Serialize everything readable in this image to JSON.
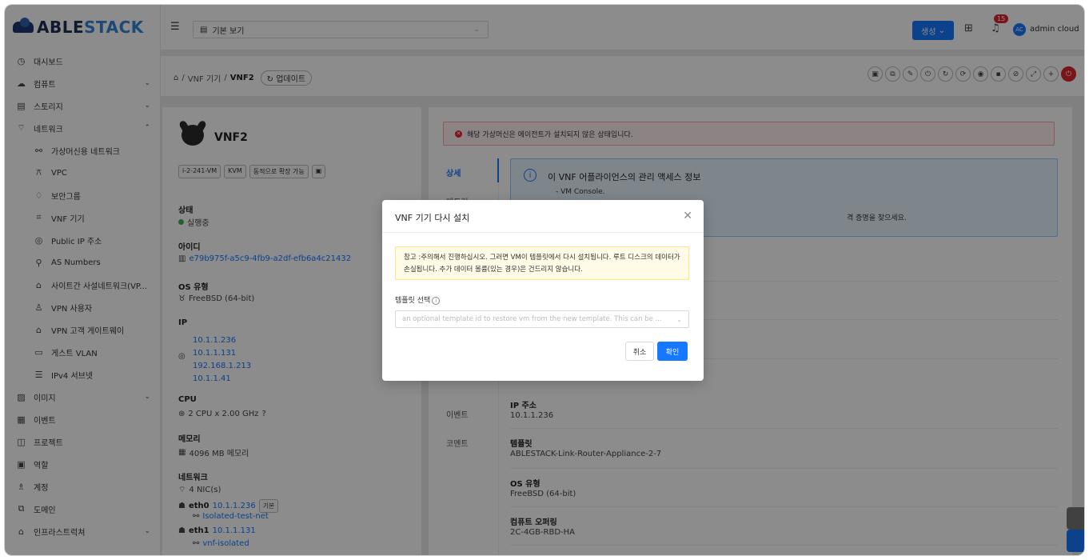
{
  "brand": {
    "part1": "ABLE",
    "part2": "STACK"
  },
  "sidebar": {
    "items": [
      {
        "icon": "◷",
        "label": "대시보드",
        "chev": "",
        "sub": false
      },
      {
        "icon": "☁",
        "label": "컴퓨트",
        "chev": "⌄",
        "sub": false
      },
      {
        "icon": "▤",
        "label": "스토리지",
        "chev": "⌄",
        "sub": false
      },
      {
        "icon": "⌔",
        "label": "네트워크",
        "chev": "⌃",
        "sub": false
      },
      {
        "icon": "⚯",
        "label": "가상머신용 네트워크",
        "chev": "",
        "sub": true
      },
      {
        "icon": "⚻",
        "label": "VPC",
        "chev": "",
        "sub": true
      },
      {
        "icon": "♢",
        "label": "보안그룹",
        "chev": "",
        "sub": true
      },
      {
        "icon": "⌗",
        "label": "VNF 기기",
        "chev": "",
        "sub": true
      },
      {
        "icon": "◎",
        "label": "Public IP 주소",
        "chev": "",
        "sub": true
      },
      {
        "icon": "⚲",
        "label": "AS Numbers",
        "chev": "",
        "sub": true
      },
      {
        "icon": "⌂",
        "label": "사이트간 사설네트워크(VP...",
        "chev": "",
        "sub": true
      },
      {
        "icon": "♙",
        "label": "VPN 사용자",
        "chev": "",
        "sub": true
      },
      {
        "icon": "⌂",
        "label": "VPN 고객 게이트웨이",
        "chev": "",
        "sub": true
      },
      {
        "icon": "▭",
        "label": "게스트 VLAN",
        "chev": "",
        "sub": true
      },
      {
        "icon": "☰",
        "label": "IPv4 서브넷",
        "chev": "",
        "sub": true
      },
      {
        "icon": "▨",
        "label": "이미지",
        "chev": "⌄",
        "sub": false
      },
      {
        "icon": "▦",
        "label": "이벤트",
        "chev": "",
        "sub": false
      },
      {
        "icon": "◫",
        "label": "프로젝트",
        "chev": "",
        "sub": false
      },
      {
        "icon": "▣",
        "label": "역할",
        "chev": "",
        "sub": false
      },
      {
        "icon": "♗",
        "label": "계정",
        "chev": "",
        "sub": false
      },
      {
        "icon": "⧉",
        "label": "도메인",
        "chev": "",
        "sub": false
      },
      {
        "icon": "⌂",
        "label": "인프라스트럭쳐",
        "chev": "⌄",
        "sub": false
      }
    ]
  },
  "header": {
    "view": "기본 보기",
    "create": "생성",
    "notif_count": "15",
    "avatar": "AC",
    "user": "admin cloud"
  },
  "crumbs": {
    "vnf": "VNF 기기",
    "current": "VNF2",
    "update": "업데이트"
  },
  "actions": [
    "▣",
    "⧉",
    "✎",
    "⏻",
    "↻",
    "⟳",
    "◉",
    "▪",
    "⊘",
    "⤢",
    "+",
    "⏻"
  ],
  "vm": {
    "name": "VNF2",
    "tags": [
      "i-2-241-VM",
      "KVM",
      "동적으로 확장 가능"
    ],
    "status_label": "상태",
    "status": "실행중",
    "id_label": "아이디",
    "id": "e79b975f-a5c9-4fb9-a2df-efb6a4c21432",
    "os_label": "OS 유형",
    "os": "FreeBSD (64-bit)",
    "ip_label": "IP",
    "ips": [
      "10.1.1.236",
      "10.1.1.131",
      "192.168.1.213",
      "10.1.1.41"
    ],
    "cpu_label": "CPU",
    "cpu": "2 CPU x 2.00 GHz",
    "mem_label": "메모리",
    "mem": "4096 MB 메모리",
    "net_label": "네트워크",
    "nics": "4 NIC(s)",
    "eth0": "eth0",
    "eth0_ip": "10.1.1.236",
    "eth0_tag": "기본",
    "eth0_net": "Isolated-test-net",
    "eth1": "eth1",
    "eth1_ip": "10.1.1.131",
    "eth1_net": "vnf-isolated"
  },
  "detail": {
    "alert": "해당 가상머신은 에이전트가 설치되지 않은 상태입니다.",
    "tabs": [
      "상세",
      "메트릭",
      "이벤트",
      "코멘트"
    ],
    "info_title": "이 VNF 어플라이언스의 관리 액세스 정보",
    "info_sub": "- VM Console.",
    "info_sub2": "격 증명을 찾으세요.",
    "fields": [
      {
        "k": "IP 주소",
        "v": "10.1.1.236"
      },
      {
        "k": "템플릿",
        "v": "ABLESTACK-Link-Router-Appliance-2-7"
      },
      {
        "k": "OS 유형",
        "v": "FreeBSD (64-bit)"
      },
      {
        "k": "컴퓨트 오퍼링",
        "v": "2C-4GB-RBD-HA"
      }
    ]
  },
  "modal": {
    "title": "VNF 기기 다시 설치",
    "warning": "참고 :주의해서 진행하십시오. 그러면 VM이 템플릿에서 다시 설치됩니다. 루트 디스크의 데이터가 손실됩니다. 추가 데이터 볼륨(있는 경우)은 건드리지 않습니다.",
    "label": "템플릿 선택",
    "placeholder": "an optional template id to restore vm from the new template. This can be ...",
    "cancel": "취소",
    "ok": "확인"
  }
}
